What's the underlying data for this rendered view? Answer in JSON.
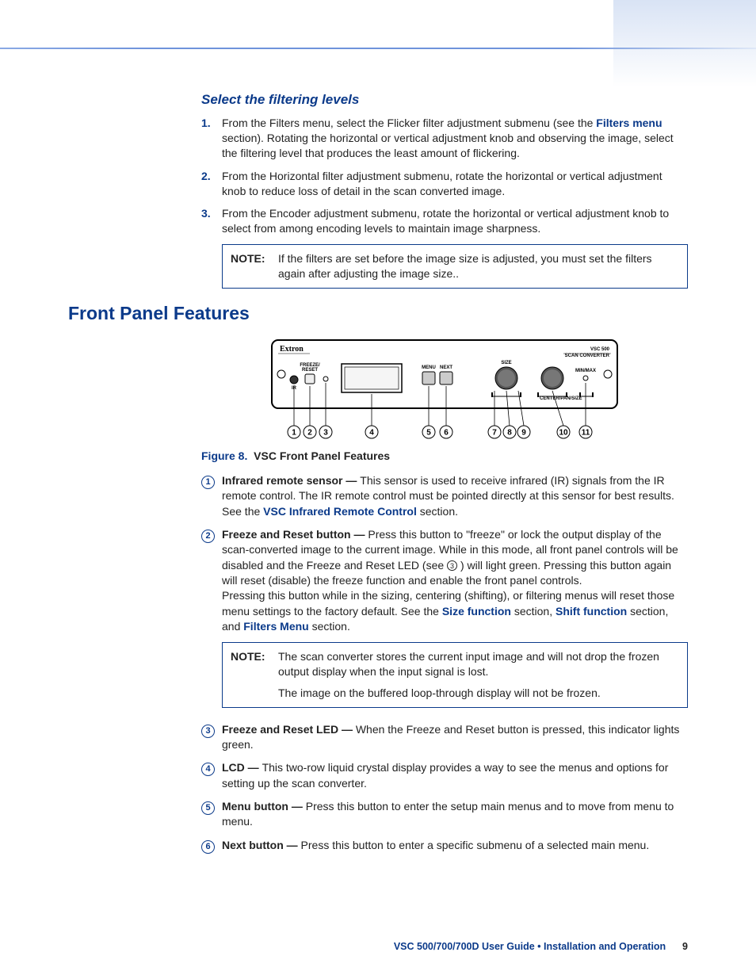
{
  "section_filter": {
    "heading": "Select the filtering levels",
    "items": [
      {
        "n": "1.",
        "text_before": "From the Filters menu, select the Flicker filter adjustment submenu (see the ",
        "link": "Filters menu",
        "text_after": " section). Rotating the horizontal or vertical adjustment knob and observing the image, select the filtering level that produces the least amount of flickering."
      },
      {
        "n": "2.",
        "text": "From the Horizontal filter adjustment submenu, rotate the horizontal or vertical adjustment knob to reduce loss of detail in the scan converted image."
      },
      {
        "n": "3.",
        "text": "From the Encoder adjustment submenu, rotate the horizontal or vertical adjustment knob to select from among encoding levels to maintain image sharpness."
      }
    ],
    "note_label": "NOTE:",
    "note_text": "If the filters are set before the image size is adjusted, you must set the filters again after adjusting the image size.."
  },
  "heading_fpf": "Front Panel Features",
  "figure": {
    "n": "Figure 8.",
    "title": "VSC Front Panel Features",
    "brand": "Extron",
    "model": "VSC 500",
    "model_sub": "SCAN CONVERTER",
    "labels": {
      "ir": "IR",
      "freeze": "FREEZE/",
      "reset": "RESET",
      "menu": "MENU",
      "next": "NEXT",
      "size": "SIZE",
      "minmax": "MIN/MAX",
      "center": "CENTER/PAN/SIZE"
    },
    "callout_numbers": [
      "1",
      "2",
      "3",
      "4",
      "5",
      "6",
      "7",
      "8",
      "9",
      "10",
      "11"
    ]
  },
  "callouts": [
    {
      "n": "1",
      "title": "Infrared remote sensor — ",
      "body_before": " This sensor is used to receive infrared (IR) signals from the IR remote control. The IR remote control must be pointed directly at this sensor for best results.  See the ",
      "link": "VSC Infrared Remote Control",
      "body_after": " section."
    },
    {
      "n": "2",
      "title": "Freeze and Reset button — ",
      "body": " Press this button to \"freeze\" or lock the output display of the scan-converted image to the current image. While in this mode, all front panel controls will be disabled and the Freeze and Reset LED (see ③ ) will  light green. Pressing this button again will reset (disable) the freeze function and enable the front panel controls.",
      "body2_before": "Pressing this button while in the sizing, centering (shifting), or filtering menus will reset those menu settings to the factory default. See the ",
      "link1": "Size function",
      "body2_mid1": " section, ",
      "link2": "Shift function",
      "body2_mid2": " section, and ",
      "link3": "Filters Menu",
      "body2_after": " section."
    }
  ],
  "note2": {
    "label": "NOTE:",
    "line1": "The scan converter stores the current input image and will not drop the frozen output display when the input signal is lost.",
    "line2": "The image on the buffered loop-through display will not be frozen."
  },
  "callouts_after": [
    {
      "n": "3",
      "title": "Freeze and Reset LED — ",
      "body": " When the Freeze and Reset button is pressed, this indicator lights green."
    },
    {
      "n": "4",
      "title": "LCD — ",
      "body": " This two-row liquid crystal display provides a way to see the menus and options for setting up the scan converter."
    },
    {
      "n": "5",
      "title": "Menu button — ",
      "body": " Press this button to enter the setup main menus and to move from menu to menu."
    },
    {
      "n": "6",
      "title": "Next button — ",
      "body": " Press this button to enter a specific submenu of a selected main menu."
    }
  ],
  "footer": {
    "title": "VSC 500/700/700D User Guide • Installation and Operation",
    "page": "9"
  }
}
